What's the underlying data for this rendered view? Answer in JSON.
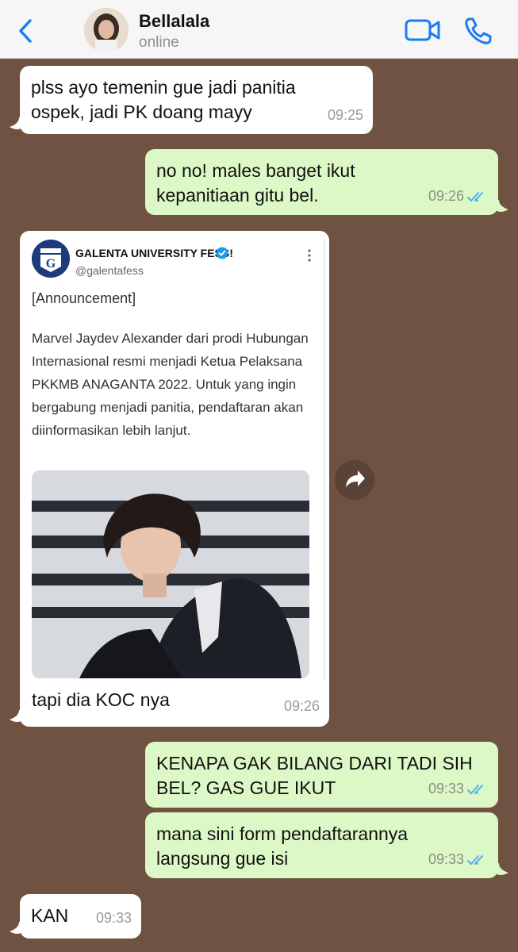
{
  "header": {
    "contact_name": "Bellalala",
    "status": "online"
  },
  "messages": [
    {
      "dir": "in",
      "text": "plss ayo temenin gue jadi panitia ospek, jadi PK doang mayy",
      "time": "09:25"
    },
    {
      "dir": "out",
      "text": "no no! males banget ikut kepanitiaan gitu bel.",
      "time": "09:26",
      "read": true
    },
    {
      "dir": "in",
      "text": "tapi dia KOC nya",
      "time": "09:26"
    },
    {
      "dir": "out",
      "text": "KENAPA GAK BILANG DARI TADI SIH BEL? GAS GUE IKUT",
      "time": "09:33",
      "read": true
    },
    {
      "dir": "out",
      "text": "mana sini form pendaftarannya langsung gue isi",
      "time": "09:33",
      "read": true
    },
    {
      "dir": "in",
      "text": "KAN",
      "time": "09:33"
    }
  ],
  "tweet": {
    "account_name": "GALENTA UNIVERSITY FESS!",
    "handle": "@galentafess",
    "logo_letter": "G",
    "title": "[Announcement]",
    "body": "Marvel Jaydev Alexander dari prodi Hubungan Internasional resmi menjadi Ketua Pelaksana PKKMB ANAGANTA 2022. Untuk yang ingin bergabung menjadi panitia, pendaftaran akan diinformasikan lebih lanjut."
  },
  "colors": {
    "chat_background": "#6f5241",
    "outgoing_bubble": "#dcf8c6",
    "incoming_bubble": "#ffffff",
    "accent": "#1a7cf0",
    "read_tick": "#4fb0f0"
  },
  "icons": [
    "chevron-left-icon",
    "video-call-icon",
    "phone-icon",
    "double-check-icon",
    "verified-badge-icon",
    "more-vertical-icon",
    "forward-icon"
  ]
}
